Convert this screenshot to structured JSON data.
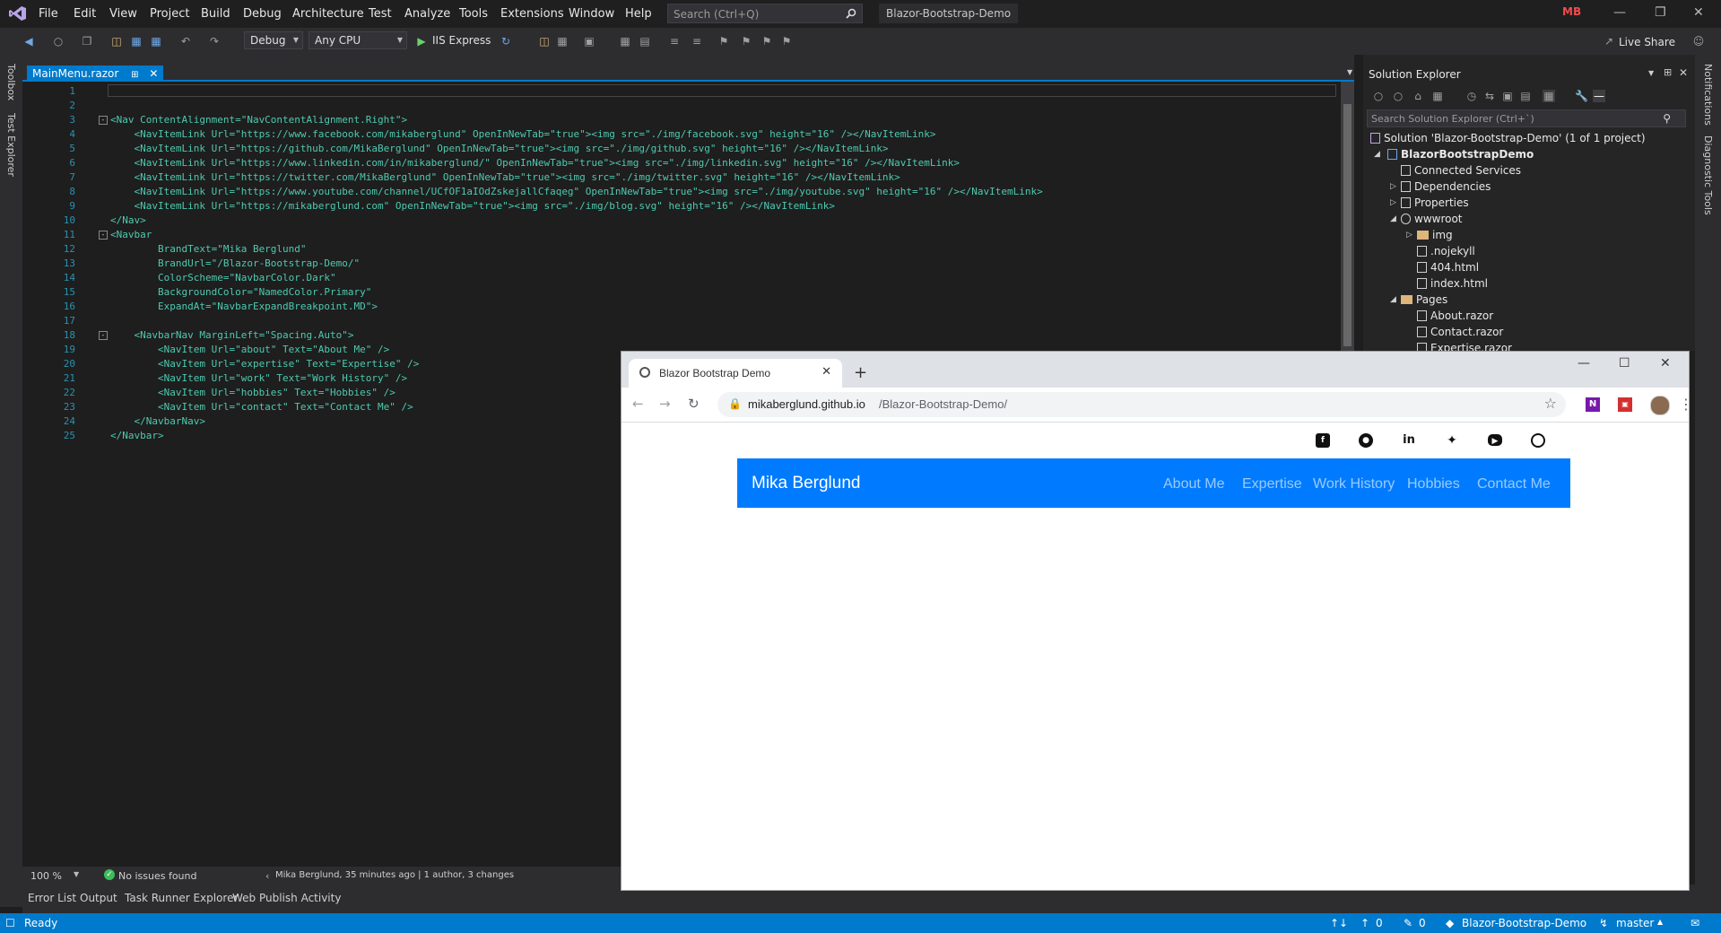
{
  "menu": [
    "File",
    "Edit",
    "View",
    "Project",
    "Build",
    "Debug",
    "Architecture",
    "Test",
    "Analyze",
    "Tools",
    "Extensions",
    "Window",
    "Help"
  ],
  "search": {
    "placeholder": "Search (Ctrl+Q)"
  },
  "solution_title": "Blazor-Bootstrap-Demo",
  "user_initials": "MB",
  "toolbar": {
    "config": "Debug",
    "platform": "Any CPU",
    "run": "IIS Express",
    "live_share": "Live Share"
  },
  "side": {
    "left": [
      "Toolbox",
      "Test Explorer"
    ],
    "right": [
      "Notifications",
      "Diagnostic Tools"
    ]
  },
  "editor": {
    "tab": "MainMenu.razor",
    "lines": [
      "1",
      "2",
      "3",
      "4",
      "5",
      "6",
      "7",
      "8",
      "9",
      "10",
      "11",
      "12",
      "13",
      "14",
      "15",
      "16",
      "17",
      "18",
      "19",
      "20",
      "21",
      "22",
      "23",
      "24",
      "25"
    ],
    "zoom": "100 %",
    "issues": "No issues found",
    "blame": "Mika Berglund, 35 minutes ago | 1 author, 3 changes"
  },
  "code": {
    "l3": "<Nav ContentAlignment=\"NavContentAlignment.Right\">",
    "l4": "    <NavItemLink Url=\"https://www.facebook.com/mikaberglund\" OpenInNewTab=\"true\"><img src=\"./img/facebook.svg\" height=\"16\" /></NavItemLink>",
    "l5": "    <NavItemLink Url=\"https://github.com/MikaBerglund\" OpenInNewTab=\"true\"><img src=\"./img/github.svg\" height=\"16\" /></NavItemLink>",
    "l6": "    <NavItemLink Url=\"https://www.linkedin.com/in/mikaberglund/\" OpenInNewTab=\"true\"><img src=\"./img/linkedin.svg\" height=\"16\" /></NavItemLink>",
    "l7": "    <NavItemLink Url=\"https://twitter.com/MikaBerglund\" OpenInNewTab=\"true\"><img src=\"./img/twitter.svg\" height=\"16\" /></NavItemLink>",
    "l8": "    <NavItemLink Url=\"https://www.youtube.com/channel/UCfOF1aIOdZskejallCfaqeg\" OpenInNewTab=\"true\"><img src=\"./img/youtube.svg\" height=\"16\" /></NavItemLink>",
    "l9": "    <NavItemLink Url=\"https://mikaberglund.com\" OpenInNewTab=\"true\"><img src=\"./img/blog.svg\" height=\"16\" /></NavItemLink>",
    "l10": "</Nav>",
    "l11": "<Navbar",
    "l12": "        BrandText=\"Mika Berglund\"",
    "l13": "        BrandUrl=\"/Blazor-Bootstrap-Demo/\"",
    "l14": "        ColorScheme=\"NavbarColor.Dark\"",
    "l15": "        BackgroundColor=\"NamedColor.Primary\"",
    "l16": "        ExpandAt=\"NavbarExpandBreakpoint.MD\">",
    "l18": "    <NavbarNav MarginLeft=\"Spacing.Auto\">",
    "l19": "        <NavItem Url=\"about\" Text=\"About Me\" />",
    "l20": "        <NavItem Url=\"expertise\" Text=\"Expertise\" />",
    "l21": "        <NavItem Url=\"work\" Text=\"Work History\" />",
    "l22": "        <NavItem Url=\"hobbies\" Text=\"Hobbies\" />",
    "l23": "        <NavItem Url=\"contact\" Text=\"Contact Me\" />",
    "l24": "    </NavbarNav>",
    "l25": "</Navbar>"
  },
  "solution_explorer": {
    "title": "Solution Explorer",
    "search_placeholder": "Search Solution Explorer (Ctrl+`)",
    "items": [
      "Solution 'Blazor-Bootstrap-Demo' (1 of 1 project)",
      "BlazorBootstrapDemo",
      "Connected Services",
      "Dependencies",
      "Properties",
      "wwwroot",
      "img",
      ".nojekyll",
      "404.html",
      "index.html",
      "Pages",
      "About.razor",
      "Contact.razor",
      "Expertise.razor"
    ]
  },
  "bottom_tabs": [
    "Error List",
    "Output",
    "Task Runner Explorer",
    "Web Publish Activity"
  ],
  "statusbar": {
    "ready": "Ready",
    "up": "0",
    "pencil": "0",
    "repo": "Blazor-Bootstrap-Demo",
    "branch": "master"
  },
  "browser": {
    "tab_title": "Blazor Bootstrap Demo",
    "url_host": "mikaberglund.github.io",
    "url_path": "/Blazor-Bootstrap-Demo/",
    "brand": "Mika Berglund",
    "nav": [
      "About Me",
      "Expertise",
      "Work History",
      "Hobbies",
      "Contact Me"
    ]
  },
  "colors": {
    "accent": "#007acc",
    "navbar": "#007bff"
  }
}
